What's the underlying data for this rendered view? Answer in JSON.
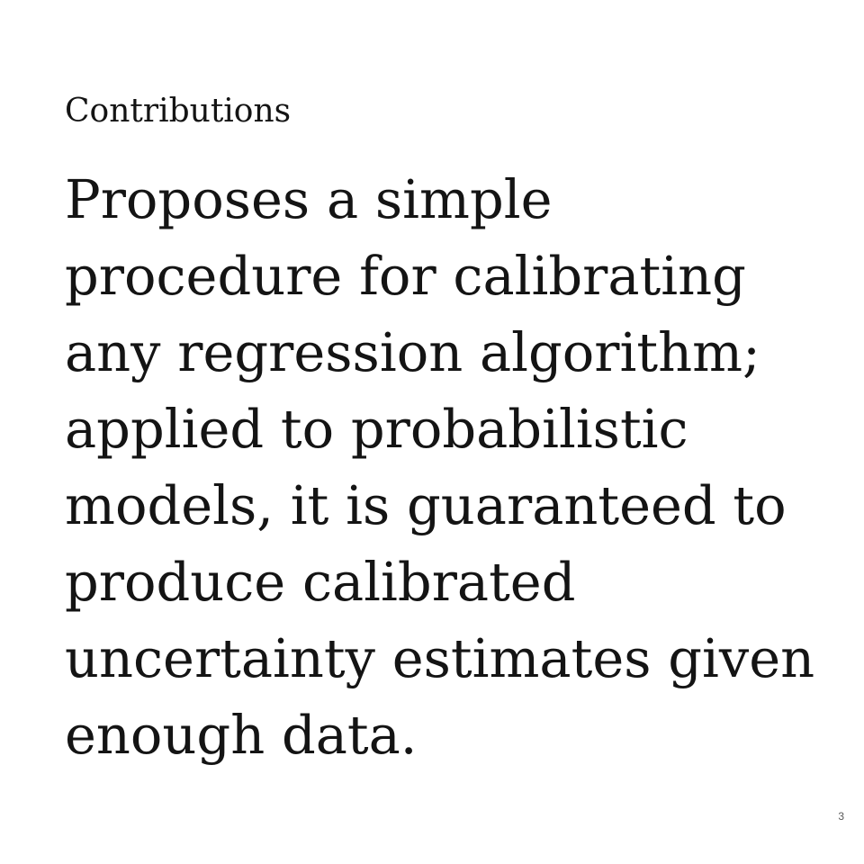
{
  "slide": {
    "heading": "Contributions",
    "body_lines": [
      "Proposes a simple",
      "procedure for calibrating",
      "any regression algorithm;",
      "applied to probabilistic",
      "models, it is guaranteed to",
      "produce calibrated",
      "uncertainty estimates given",
      "enough data."
    ],
    "page_number": "3"
  }
}
